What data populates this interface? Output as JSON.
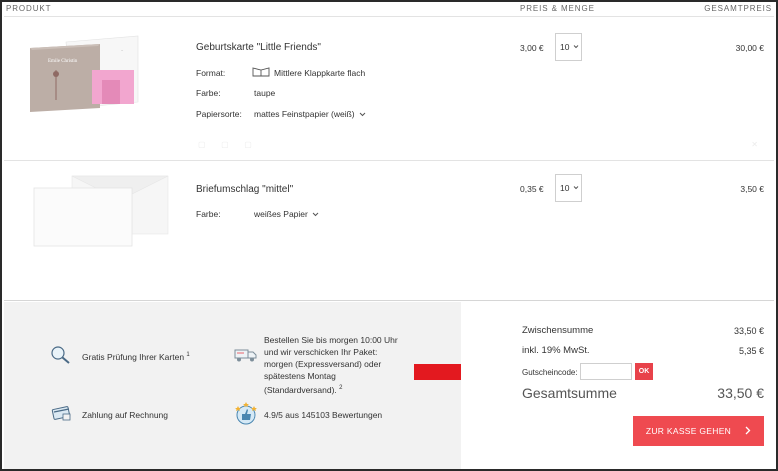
{
  "header": {
    "product": "PRODUKT",
    "price_qty": "PREIS & MENGE",
    "total": "GESAMTPREIS"
  },
  "items": [
    {
      "title": "Geburtskarte \"Little Friends\"",
      "format_label": "Format:",
      "format_value": "Mittlere Klappkarte flach",
      "color_label": "Farbe:",
      "color_value": "taupe",
      "paper_label": "Papiersorte:",
      "paper_value": "mattes Feinstpapier (weiß)",
      "unit_price": "3,00 €",
      "quantity": "10",
      "total_price": "30,00 €",
      "thumb_text": "Emile Christin"
    },
    {
      "title": "Briefumschlag \"mittel\"",
      "color_label": "Farbe:",
      "color_value": "weißes Papier",
      "unit_price": "0,35 €",
      "quantity": "10",
      "total_price": "3,50 €"
    }
  ],
  "features": {
    "check": "Gratis Prüfung Ihrer Karten",
    "check_sup": "1",
    "delivery": "Bestellen Sie bis morgen 10:00 Uhr und wir verschicken Ihr Paket: morgen (Expressversand) oder spätestens Montag (Standardversand).",
    "delivery_sup": "2",
    "invoice": "Zahlung auf Rechnung",
    "rating": "4.9/5 aus 145103 Bewertungen"
  },
  "summary": {
    "subtotal_label": "Zwischensumme",
    "subtotal_value": "33,50 €",
    "tax_label": "inkl. 19% MwSt.",
    "tax_value": "5,35 €",
    "coupon_label": "Gutscheincode:",
    "coupon_value": "",
    "ok_label": "OK",
    "total_label": "Gesamtsumme",
    "total_value": "33,50 €",
    "checkout_label": "ZUR KASSE GEHEN"
  },
  "colors": {
    "accent": "#ef4a50",
    "arrow": "#e3191f",
    "panel_bg": "#f2f2f2"
  }
}
